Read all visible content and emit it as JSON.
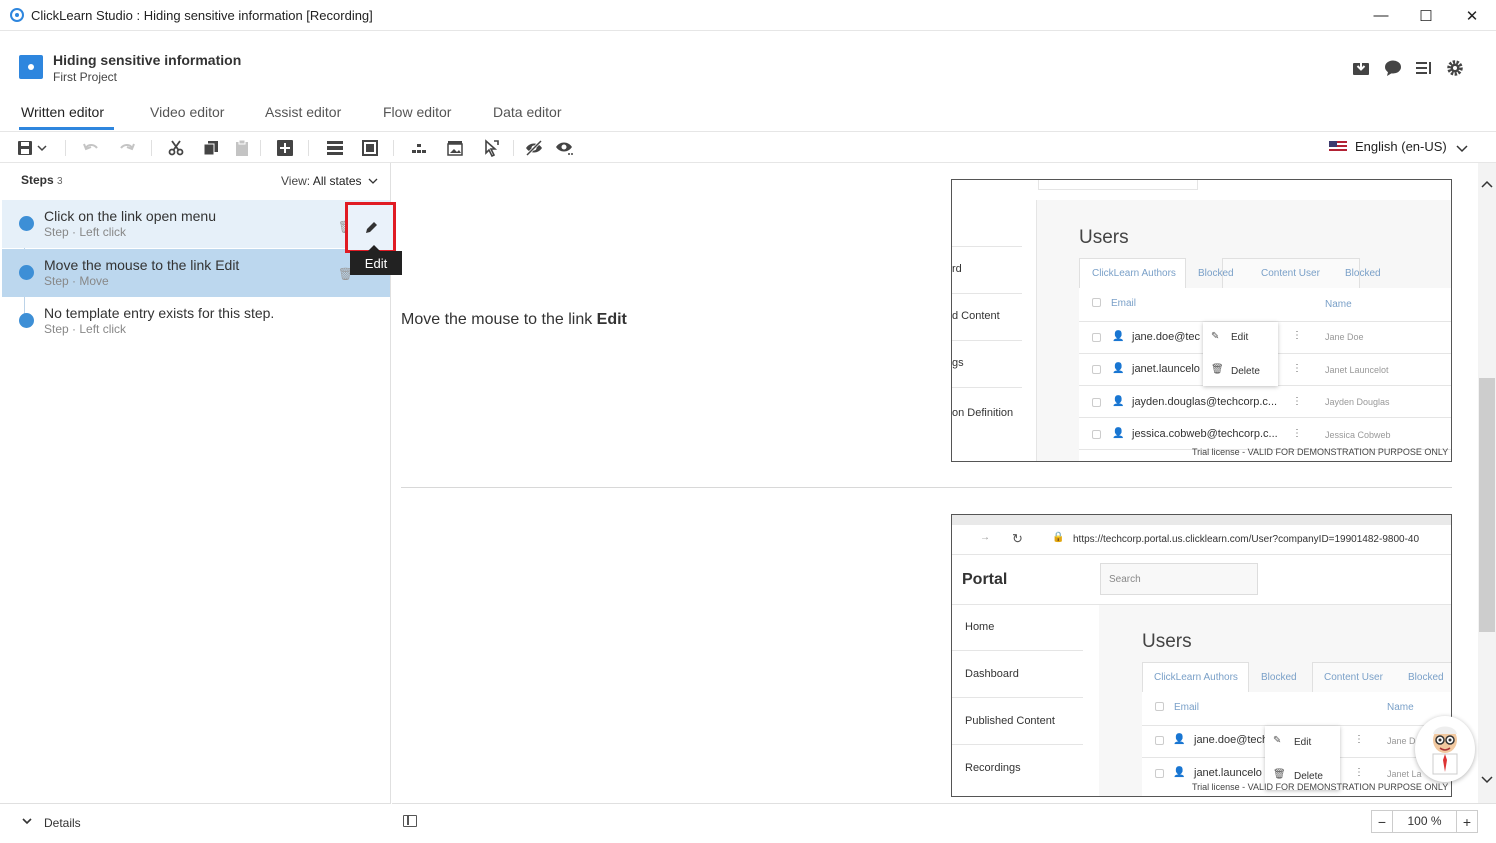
{
  "window": {
    "title": "ClickLearn Studio : Hiding sensitive information [Recording]",
    "controls": {
      "minimize": "—",
      "maximize": "☐",
      "close": "✕"
    }
  },
  "project": {
    "title": "Hiding sensitive information",
    "subtitle": "First Project",
    "header_icons": [
      "inbox-download-icon",
      "chat-bubble-icon",
      "list-icon",
      "gear-icon"
    ]
  },
  "tabs": [
    "Written editor",
    "Video editor",
    "Assist editor",
    "Flow editor",
    "Data editor"
  ],
  "toolbar": {
    "icons": [
      "save-icon",
      "undo-icon",
      "redo-icon",
      "cut-icon",
      "copy-icon",
      "paste-icon",
      "add-step-icon",
      "layout-icon",
      "frame-icon",
      "hierarchy-icon",
      "image-icon",
      "cursor-icon",
      "hide-icon",
      "preview-icon"
    ],
    "language": "English (en-US)"
  },
  "steps_panel": {
    "label": "Steps",
    "count": "3",
    "view_label": "View:",
    "view_value": "All states",
    "steps": [
      {
        "title": "Click on the link open menu",
        "meta": "Step · Left click"
      },
      {
        "title": "Move the mouse to the link Edit",
        "meta": "Step · Move"
      },
      {
        "title": "No template entry exists for this step.",
        "meta": "Step · Left click"
      }
    ],
    "tooltip": "Edit",
    "details_label": "Details"
  },
  "content": {
    "step_text_prefix": "Move the mouse to the link ",
    "step_text_bold": "Edit",
    "shot1": {
      "nav": [
        "rd",
        "d Content",
        "gs",
        "on Definition"
      ],
      "users_title": "Users",
      "tabs": [
        "ClickLearn Authors",
        "Blocked",
        "Content User",
        "Blocked"
      ],
      "col_email": "Email",
      "col_name": "Name",
      "rows": [
        {
          "email": "jane.doe@tec",
          "name": "Jane Doe"
        },
        {
          "email": "janet.launcelo",
          "name": "Janet Launcelot"
        },
        {
          "email": "jayden.douglas@techcorp.c...",
          "name": "Jayden Douglas"
        },
        {
          "email": "jessica.cobweb@techcorp.c...",
          "name": "Jessica Cobweb"
        }
      ],
      "menu": [
        "Edit",
        "Delete"
      ],
      "trial": "Trial license - VALID FOR DEMONSTRATION PURPOSE ONLY"
    },
    "shot2": {
      "url": "https://techcorp.portal.us.clicklearn.com/User?companyID=19901482-9800-40",
      "portal": "Portal",
      "search": "Search",
      "nav": [
        "Home",
        "Dashboard",
        "Published Content",
        "Recordings"
      ],
      "users_title": "Users",
      "tabs": [
        "ClickLearn Authors",
        "Blocked",
        "Content User",
        "Blocked"
      ],
      "col_email": "Email",
      "col_name": "Name",
      "rows": [
        {
          "email": "jane.doe@tech",
          "name": "Jane D"
        },
        {
          "email": "janet.launcelo",
          "name": "Janet La"
        }
      ],
      "menu": [
        "Edit",
        "Delete"
      ],
      "trial": "Trial license - VALID FOR DEMONSTRATION PURPOSE ONLY"
    }
  },
  "zoom": {
    "minus": "−",
    "value": "100 %",
    "plus": "+"
  }
}
